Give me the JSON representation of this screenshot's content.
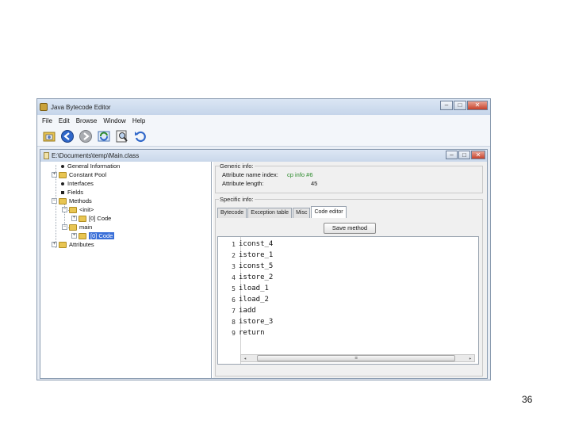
{
  "window": {
    "title": "Java Bytecode Editor",
    "buttons": {
      "minimize": "–",
      "maximize": "□",
      "close": "✕"
    }
  },
  "menu": [
    "File",
    "Edit",
    "Browse",
    "Window",
    "Help"
  ],
  "toolbar": {
    "icons": [
      "open-file-icon",
      "back-icon",
      "forward-icon",
      "refresh-icon",
      "inspect-icon",
      "undo-icon"
    ]
  },
  "document": {
    "path": "E:\\Documents\\temp\\Main.class",
    "buttons": {
      "minimize": "–",
      "maximize": "□",
      "close": "✕"
    }
  },
  "tree": {
    "general_information": "General Information",
    "constant_pool": "Constant Pool",
    "interfaces": "Interfaces",
    "fields": "Fields",
    "methods": "Methods",
    "init": "<init>",
    "init_code": "[0] Code",
    "main": "main",
    "main_code": "[0] Code",
    "attributes": "Attributes"
  },
  "generic_info": {
    "label": "Generic info:",
    "attr_name_index_label": "Attribute name index:",
    "attr_name_index_value": "cp info #6",
    "attr_length_label": "Attribute length:",
    "attr_length_value": "45"
  },
  "specific_info": {
    "label": "Specific info:",
    "tabs": [
      "Bytecode",
      "Exception table",
      "Misc",
      "Code editor"
    ],
    "save_label": "Save method"
  },
  "code": {
    "lines": [
      {
        "n": "1",
        "text": "iconst_4"
      },
      {
        "n": "2",
        "text": "istore_1"
      },
      {
        "n": "3",
        "text": "iconst_5"
      },
      {
        "n": "4",
        "text": "istore_2"
      },
      {
        "n": "5",
        "text": "iload_1"
      },
      {
        "n": "6",
        "text": "iload_2"
      },
      {
        "n": "7",
        "text": "iadd"
      },
      {
        "n": "8",
        "text": "istore_3"
      },
      {
        "n": "9",
        "text": "return"
      }
    ]
  },
  "scrollbar": {
    "left": "◂",
    "grip": "≡",
    "right": "▸"
  },
  "page_number": "36"
}
